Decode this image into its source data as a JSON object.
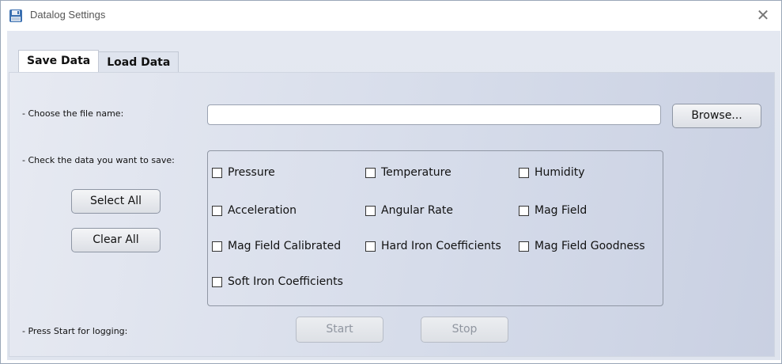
{
  "window": {
    "title": "Datalog Settings",
    "close_glyph": "✕"
  },
  "tabs": [
    {
      "label": "Save Data",
      "active": true
    },
    {
      "label": "Load Data",
      "active": false
    }
  ],
  "save_data": {
    "file_name_label": "- Choose the file name:",
    "file_name_value": "",
    "browse_label": "Browse...",
    "check_label": "- Check the data you want to save:",
    "select_all_label": "Select All",
    "clear_all_label": "Clear All",
    "checkboxes": [
      {
        "label": "Pressure",
        "checked": false
      },
      {
        "label": "Temperature",
        "checked": false
      },
      {
        "label": "Humidity",
        "checked": false
      },
      {
        "label": "Acceleration",
        "checked": false
      },
      {
        "label": "Angular Rate",
        "checked": false
      },
      {
        "label": "Mag Field",
        "checked": false
      },
      {
        "label": "Mag Field Calibrated",
        "checked": false
      },
      {
        "label": "Hard Iron Coefficients",
        "checked": false
      },
      {
        "label": "Mag Field Goodness",
        "checked": false
      },
      {
        "label": "Soft Iron Coefficients",
        "checked": false
      }
    ],
    "press_start_label": "- Press Start for logging:",
    "start_label": "Start",
    "stop_label": "Stop",
    "start_enabled": false,
    "stop_enabled": false
  },
  "colors": {
    "panel_gradient_start": "#e7eaf2",
    "panel_gradient_end": "#c9d0e2",
    "disabled_text": "#9096a0"
  },
  "icons": {
    "app_icon": "floppy-disk-icon",
    "close": "close-icon"
  }
}
